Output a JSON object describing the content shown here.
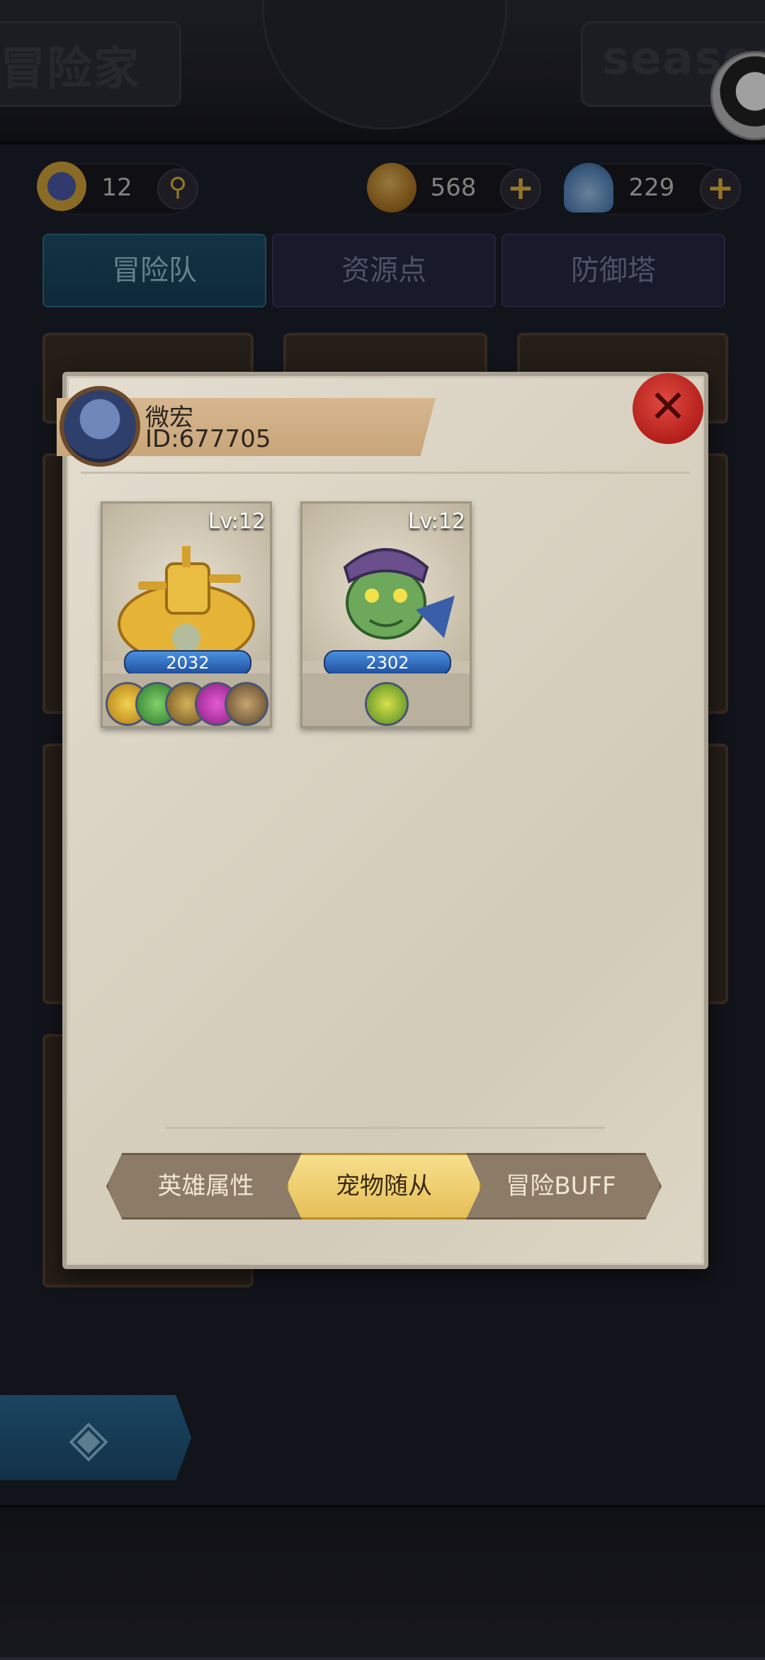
{
  "top_banner": {
    "left_text": "冒险家",
    "right_text": "season"
  },
  "resources": {
    "level": {
      "icon": "level-badge-icon",
      "value": "12"
    },
    "coins": {
      "icon": "coin-icon",
      "value": "568"
    },
    "shells": {
      "icon": "shell-icon",
      "value": "229"
    }
  },
  "tabs": [
    {
      "label": "冒险队",
      "active": true
    },
    {
      "label": "资源点",
      "active": false
    },
    {
      "label": "防御塔",
      "active": false
    }
  ],
  "modal": {
    "player": {
      "name": "微宏",
      "id": "ID:677705"
    },
    "close_icon": "close-icon",
    "pets": [
      {
        "level": "Lv:12",
        "power": "2032",
        "gem_count": 5
      },
      {
        "level": "Lv:12",
        "power": "2302",
        "gem_count": 1
      }
    ],
    "subtabs": [
      {
        "label": "英雄属性",
        "active": false
      },
      {
        "label": "宠物随从",
        "active": true
      },
      {
        "label": "冒险BUFF",
        "active": false
      }
    ]
  },
  "bottom": {
    "back_icon": "back-arrow-icon"
  },
  "colors": {
    "accent_gold": "#e6bf57",
    "close_red": "#b41f1c",
    "tab_active": "#174058"
  }
}
